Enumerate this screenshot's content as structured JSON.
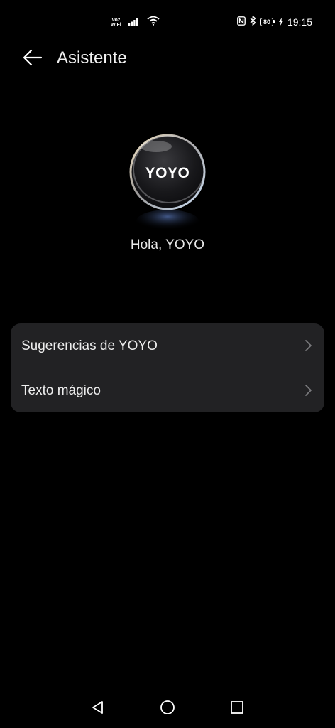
{
  "status_bar": {
    "voz_line1": "Voz",
    "voz_line2": "WiFi",
    "battery_level": "80",
    "time": "19:15",
    "icons": [
      "signal-icon",
      "wifi-icon",
      "nfc-icon",
      "bluetooth-icon",
      "battery-icon",
      "charging-icon"
    ]
  },
  "header": {
    "title": "Asistente",
    "back_icon": "back-arrow-icon"
  },
  "hero": {
    "logo_text": "YOYO",
    "greeting": "Hola, YOYO"
  },
  "menu": {
    "items": [
      {
        "label": "Sugerencias de YOYO",
        "icon": "chevron-right-icon"
      },
      {
        "label": "Texto mágico",
        "icon": "chevron-right-icon"
      }
    ]
  },
  "nav_bar": {
    "icons": [
      "back-triangle-icon",
      "home-circle-icon",
      "recents-square-icon"
    ]
  },
  "colors": {
    "background": "#000000",
    "card": "#222224",
    "divider": "#3a3a3c",
    "text": "#ededed"
  }
}
